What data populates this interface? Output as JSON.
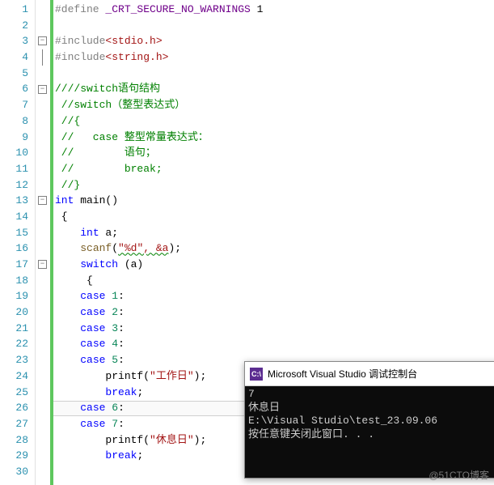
{
  "lines": [
    {
      "n": 1,
      "code": [
        {
          "t": "#define ",
          "c": "preproc"
        },
        {
          "t": "_CRT_SECURE_NO_WARNINGS",
          "c": "macro"
        },
        {
          "t": " 1",
          "c": "black"
        }
      ]
    },
    {
      "n": 2,
      "code": []
    },
    {
      "n": 3,
      "fold": true,
      "code": [
        {
          "t": "#include",
          "c": "preproc"
        },
        {
          "t": "<stdio.h>",
          "c": "angle"
        }
      ]
    },
    {
      "n": 4,
      "foldLine": true,
      "code": [
        {
          "t": "#include",
          "c": "preproc"
        },
        {
          "t": "<string.h>",
          "c": "angle"
        }
      ]
    },
    {
      "n": 5,
      "code": []
    },
    {
      "n": 6,
      "fold": true,
      "code": [
        {
          "t": "////switch语句结构",
          "c": "comment"
        }
      ]
    },
    {
      "n": 7,
      "code": [
        {
          "t": " //switch（整型表达式）",
          "c": "comment"
        }
      ]
    },
    {
      "n": 8,
      "code": [
        {
          "t": " //{",
          "c": "comment"
        }
      ]
    },
    {
      "n": 9,
      "code": [
        {
          "t": " //   case 整型常量表达式：",
          "c": "comment"
        }
      ]
    },
    {
      "n": 10,
      "code": [
        {
          "t": " //        语句；",
          "c": "comment"
        }
      ]
    },
    {
      "n": 11,
      "code": [
        {
          "t": " //        break;",
          "c": "comment"
        }
      ]
    },
    {
      "n": 12,
      "code": [
        {
          "t": " //}",
          "c": "comment"
        }
      ]
    },
    {
      "n": 13,
      "fold": true,
      "code": [
        {
          "t": "int",
          "c": "kw"
        },
        {
          "t": " main()",
          "c": "black"
        }
      ]
    },
    {
      "n": 14,
      "code": [
        {
          "t": " {",
          "c": "black"
        }
      ]
    },
    {
      "n": 15,
      "code": [
        {
          "t": "    ",
          "c": "black"
        },
        {
          "t": "int",
          "c": "kw"
        },
        {
          "t": " a;",
          "c": "black"
        }
      ]
    },
    {
      "n": 16,
      "code": [
        {
          "t": "    ",
          "c": "black"
        },
        {
          "t": "scanf",
          "c": "func"
        },
        {
          "t": "(",
          "c": "black"
        },
        {
          "t": "\"%d\", &a",
          "c": "string wavy"
        },
        {
          "t": ");",
          "c": "black"
        }
      ]
    },
    {
      "n": 17,
      "fold": true,
      "code": [
        {
          "t": "    ",
          "c": "black"
        },
        {
          "t": "switch",
          "c": "kw"
        },
        {
          "t": " (a)",
          "c": "black"
        }
      ]
    },
    {
      "n": 18,
      "code": [
        {
          "t": "     {",
          "c": "black"
        }
      ]
    },
    {
      "n": 19,
      "code": [
        {
          "t": "    ",
          "c": "black"
        },
        {
          "t": "case",
          "c": "kw"
        },
        {
          "t": " ",
          "c": "black"
        },
        {
          "t": "1",
          "c": "num"
        },
        {
          "t": ":",
          "c": "black"
        }
      ]
    },
    {
      "n": 20,
      "code": [
        {
          "t": "    ",
          "c": "black"
        },
        {
          "t": "case",
          "c": "kw"
        },
        {
          "t": " ",
          "c": "black"
        },
        {
          "t": "2",
          "c": "num"
        },
        {
          "t": ":",
          "c": "black"
        }
      ]
    },
    {
      "n": 21,
      "code": [
        {
          "t": "    ",
          "c": "black"
        },
        {
          "t": "case",
          "c": "kw"
        },
        {
          "t": " ",
          "c": "black"
        },
        {
          "t": "3",
          "c": "num"
        },
        {
          "t": ":",
          "c": "black"
        }
      ]
    },
    {
      "n": 22,
      "code": [
        {
          "t": "    ",
          "c": "black"
        },
        {
          "t": "case",
          "c": "kw"
        },
        {
          "t": " ",
          "c": "black"
        },
        {
          "t": "4",
          "c": "num"
        },
        {
          "t": ":",
          "c": "black"
        }
      ]
    },
    {
      "n": 23,
      "code": [
        {
          "t": "    ",
          "c": "black"
        },
        {
          "t": "case",
          "c": "kw"
        },
        {
          "t": " ",
          "c": "black"
        },
        {
          "t": "5",
          "c": "num"
        },
        {
          "t": ":",
          "c": "black"
        }
      ]
    },
    {
      "n": 24,
      "code": [
        {
          "t": "        printf(",
          "c": "black"
        },
        {
          "t": "\"工作日\"",
          "c": "string"
        },
        {
          "t": ");",
          "c": "black"
        }
      ]
    },
    {
      "n": 25,
      "code": [
        {
          "t": "        ",
          "c": "black"
        },
        {
          "t": "break",
          "c": "kw"
        },
        {
          "t": ";",
          "c": "black"
        }
      ]
    },
    {
      "n": 26,
      "highlight": true,
      "code": [
        {
          "t": "    ",
          "c": "black"
        },
        {
          "t": "case",
          "c": "kw"
        },
        {
          "t": " ",
          "c": "black"
        },
        {
          "t": "6",
          "c": "num"
        },
        {
          "t": ":",
          "c": "black"
        }
      ]
    },
    {
      "n": 27,
      "code": [
        {
          "t": "    ",
          "c": "black"
        },
        {
          "t": "case",
          "c": "kw"
        },
        {
          "t": " ",
          "c": "black"
        },
        {
          "t": "7",
          "c": "num"
        },
        {
          "t": ":",
          "c": "black"
        }
      ]
    },
    {
      "n": 28,
      "code": [
        {
          "t": "        printf(",
          "c": "black"
        },
        {
          "t": "\"休息日\"",
          "c": "string"
        },
        {
          "t": ");",
          "c": "black"
        }
      ]
    },
    {
      "n": 29,
      "code": [
        {
          "t": "        ",
          "c": "black"
        },
        {
          "t": "break",
          "c": "kw"
        },
        {
          "t": ";",
          "c": "black"
        }
      ]
    },
    {
      "n": 30,
      "code": []
    }
  ],
  "console": {
    "icon_text": "C:\\",
    "title": "Microsoft Visual Studio 调试控制台",
    "output": "7\n休息日\nE:\\Visual Studio\\test_23.09.06\n按任意键关闭此窗口. . ."
  },
  "watermark": "@51CTO博客",
  "fold_glyph": "−"
}
